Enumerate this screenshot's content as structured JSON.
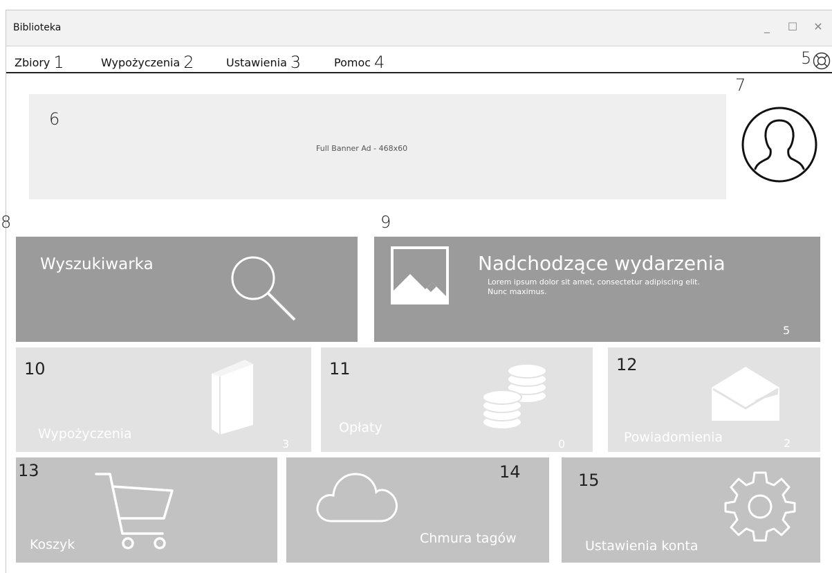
{
  "window": {
    "title": "Biblioteka",
    "controls": {
      "minimize": "_",
      "maximize": "☐",
      "close": "✕"
    }
  },
  "menu": {
    "items": [
      {
        "label": "Zbiory",
        "num": "1"
      },
      {
        "label": "Wypożyczenia",
        "num": "2"
      },
      {
        "label": "Ustawienia",
        "num": "3"
      },
      {
        "label": "Pomoc",
        "num": "4"
      }
    ],
    "help_num": "5",
    "help_icon": "lifebuoy-icon"
  },
  "banner": {
    "num": "6",
    "text": "Full Banner Ad - 468x60"
  },
  "avatar": {
    "num": "7",
    "icon": "user-avatar-icon"
  },
  "tiles": {
    "search": {
      "num": "8",
      "label": "Wyszukiwarka",
      "icon": "search-icon"
    },
    "events": {
      "num": "9",
      "title": "Nadchodzące wydarzenia",
      "desc_line1": "Lorem ipsum dolor sit amet, consectetur adipiscing elit.",
      "desc_line2": "Nunc maximus.",
      "count": "5",
      "icon": "image-icon"
    },
    "loans": {
      "num": "10",
      "label": "Wypożyczenia",
      "count": "3",
      "icon": "book-icon"
    },
    "fees": {
      "num": "11",
      "label": "Opłaty",
      "count": "0",
      "icon": "coins-icon"
    },
    "notifications": {
      "num": "12",
      "label": "Powiadomienia",
      "count": "2",
      "icon": "envelope-icon"
    },
    "cart": {
      "num": "13",
      "label": "Koszyk",
      "icon": "cart-icon"
    },
    "tags": {
      "num": "14",
      "label": "Chmura tagów",
      "icon": "cloud-icon"
    },
    "account": {
      "num": "15",
      "label": "Ustawienia konta",
      "icon": "gear-icon"
    }
  },
  "colors": {
    "dark_tile": "#9b9b9b",
    "light_tile": "#e2e2e2",
    "mid_tile": "#c2c2c2",
    "banner": "#efefef"
  }
}
